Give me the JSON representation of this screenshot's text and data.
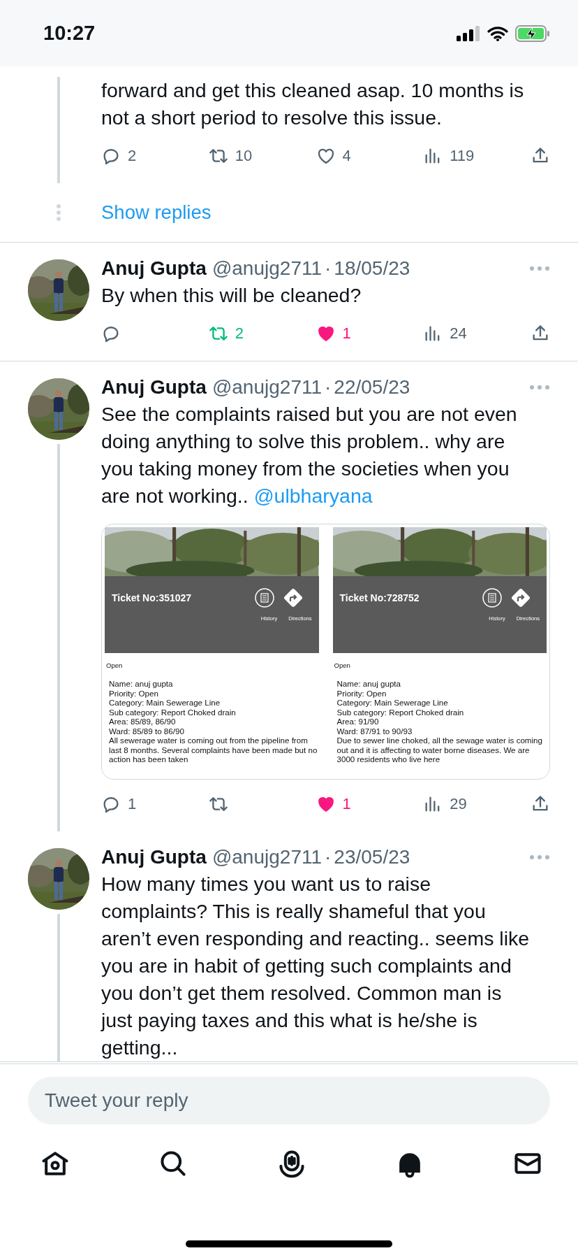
{
  "status_bar": {
    "time": "10:27"
  },
  "thread": [
    {
      "kind": "fragment",
      "text": "forward and get this cleaned asap. 10 months is not a short period to resolve this issue.",
      "connected": true,
      "divider": false,
      "actions": [
        {
          "kind": "reply",
          "count": "2",
          "on": false
        },
        {
          "kind": "retweet",
          "count": "10",
          "on": false
        },
        {
          "kind": "like",
          "count": "4",
          "on": false
        },
        {
          "kind": "views",
          "count": "119",
          "on": false
        },
        {
          "kind": "share",
          "on": false
        }
      ]
    },
    {
      "kind": "show_replies",
      "label": "Show replies",
      "divider": true
    },
    {
      "kind": "tweet",
      "name": "Anuj Gupta",
      "handle": "@anujg2711",
      "separator": "·",
      "date": "18/05/23",
      "text": "By when this will be cleaned?",
      "connected": false,
      "divider": true,
      "actions": [
        {
          "kind": "reply",
          "on": false
        },
        {
          "kind": "retweet",
          "count": "2",
          "on": true
        },
        {
          "kind": "like",
          "count": "1",
          "on": true
        },
        {
          "kind": "views",
          "count": "24",
          "on": false
        },
        {
          "kind": "share",
          "on": false
        }
      ]
    },
    {
      "kind": "tweet",
      "name": "Anuj Gupta",
      "handle": "@anujg2711",
      "separator": "·",
      "date": "22/05/23",
      "text": "See the complaints raised but you are not even doing anything to solve this problem.. why are you taking money from the societies when you are not working..",
      "link": "@ulbharyana",
      "connected": true,
      "divider": false,
      "media": [
        {
          "ticket": "Ticket No:351027",
          "history": "History",
          "directions": "Directions",
          "status": "Open",
          "fields": [
            "Name: anuj gupta",
            "Priority: Open",
            "Category: Main Sewerage Line",
            "Sub category: Report Choked drain",
            "Area: 85/89, 86/90",
            "Ward: 85/89 to 86/90"
          ],
          "description": "All sewerage water is coming out from the pipeline from last 8 months. Several complaints have been made but no action has been taken"
        },
        {
          "ticket": "Ticket No:728752",
          "history": "History",
          "directions": "Directions",
          "status": "Open",
          "fields": [
            "Name: anuj gupta",
            "Priority: Open",
            "Category: Main Sewerage Line",
            "Sub category: Report Choked drain",
            "Area: 91/90",
            "Ward: 87/91 to 90/93"
          ],
          "description": "Due to sewer line choked, all the sewage water is coming out and it is affecting to water borne diseases. We are 3000  residents who live here"
        }
      ],
      "actions": [
        {
          "kind": "reply",
          "count": "1",
          "on": false
        },
        {
          "kind": "retweet",
          "on": false
        },
        {
          "kind": "like",
          "count": "1",
          "on": true
        },
        {
          "kind": "views",
          "count": "29",
          "on": false
        },
        {
          "kind": "share",
          "on": false
        }
      ]
    },
    {
      "kind": "tweet",
      "name": "Anuj Gupta",
      "handle": "@anujg2711",
      "separator": "·",
      "date": "23/05/23",
      "text": "How many times you want us to raise complaints? This is really shameful that you aren’t even responding and reacting.. seems like you are in habit of getting such complaints and you don’t get them resolved. Common man is just paying taxes and this what is he/she is getting...",
      "connected": true,
      "divider": true
    }
  ],
  "reply_field": {
    "placeholder": "Tweet your reply"
  },
  "tab_bar": [
    {
      "kind": "home"
    },
    {
      "kind": "search"
    },
    {
      "kind": "spaces"
    },
    {
      "kind": "notifications"
    },
    {
      "kind": "messages"
    }
  ]
}
